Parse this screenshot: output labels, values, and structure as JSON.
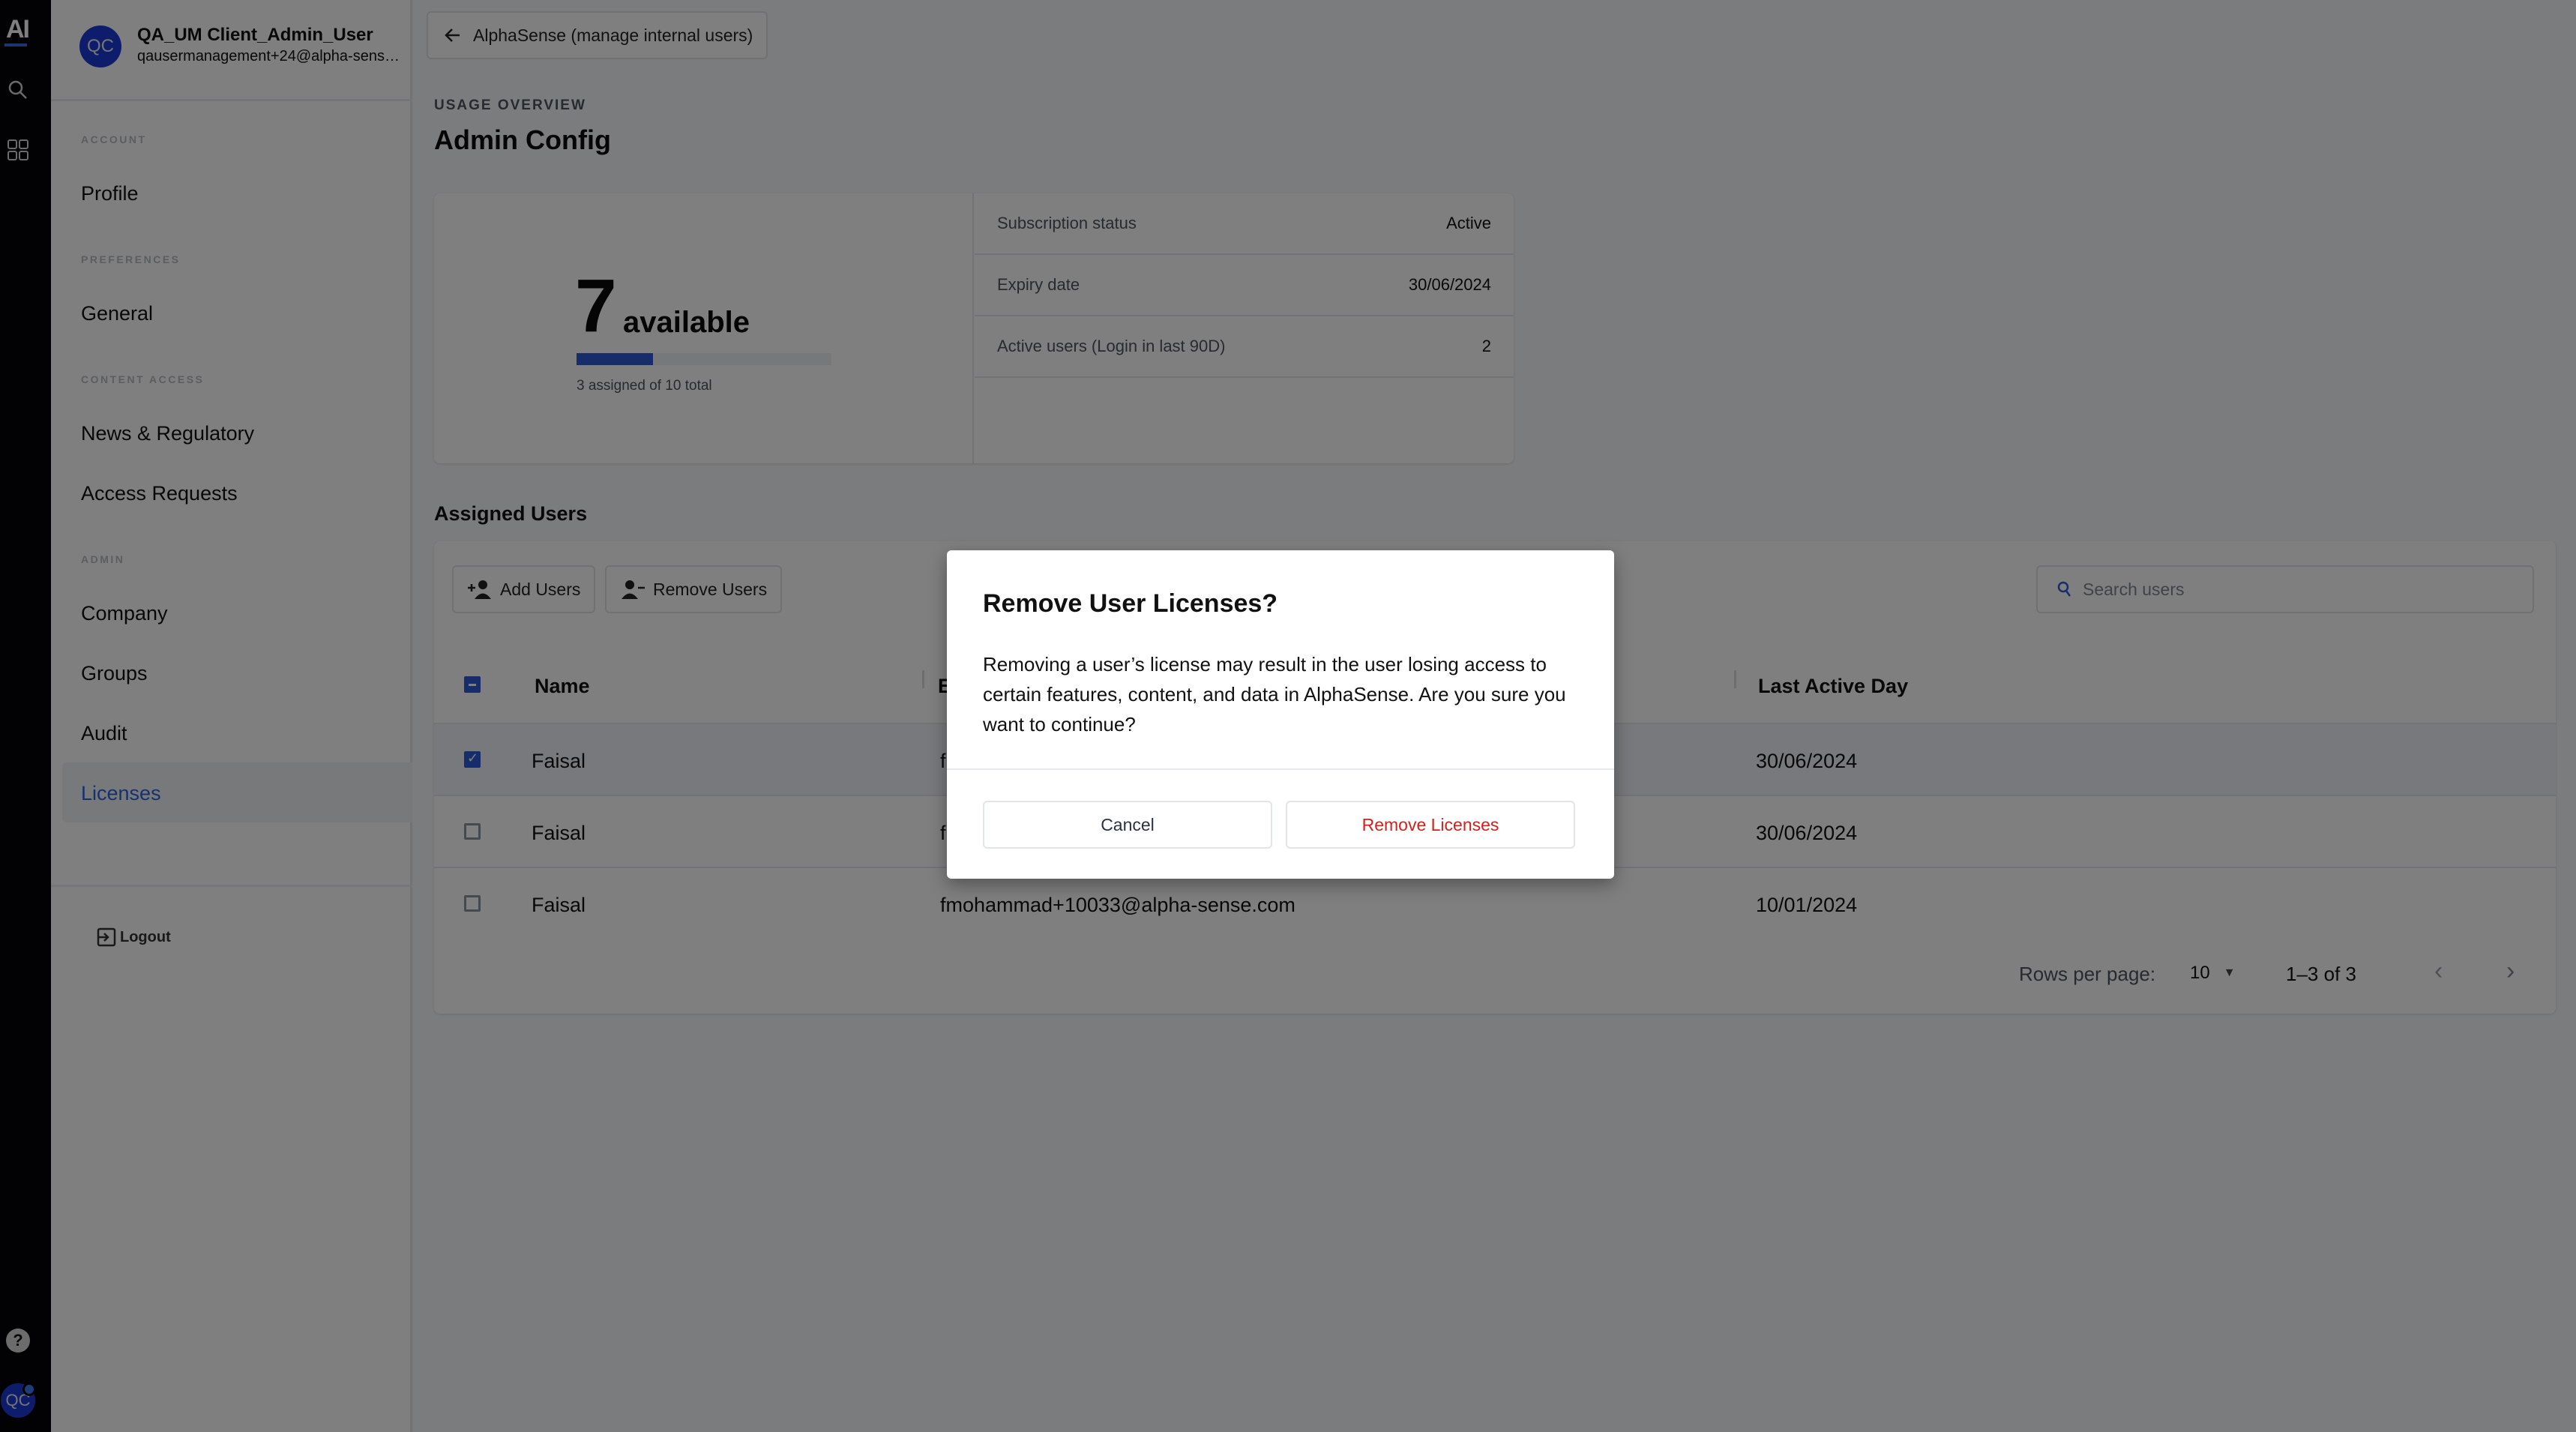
{
  "rail": {
    "logo": "AI",
    "avatar_initials": "QC",
    "help_glyph": "?",
    "icons": [
      "search-icon",
      "apps-grid-icon",
      "help-icon"
    ]
  },
  "sidebar": {
    "user": {
      "initials": "QC",
      "name": "QA_UM Client_Admin_User",
      "email": "qausermanagement+24@alpha-sense...."
    },
    "sections": [
      {
        "label": "ACCOUNT",
        "items": [
          {
            "label": "Profile",
            "active": false
          }
        ]
      },
      {
        "label": "PREFERENCES",
        "items": [
          {
            "label": "General",
            "active": false
          }
        ]
      },
      {
        "label": "CONTENT ACCESS",
        "items": [
          {
            "label": "News & Regulatory",
            "active": false
          },
          {
            "label": "Access Requests",
            "active": false
          }
        ]
      },
      {
        "label": "ADMIN",
        "items": [
          {
            "label": "Company",
            "active": false
          },
          {
            "label": "Groups",
            "active": false
          },
          {
            "label": "Audit",
            "active": false
          },
          {
            "label": "Licenses",
            "active": true
          }
        ]
      }
    ],
    "logout_label": "Logout"
  },
  "main": {
    "back_button_label": "AlphaSense (manage internal users)",
    "eyebrow": "USAGE OVERVIEW",
    "title": "Admin Config",
    "usage": {
      "available_count": "7",
      "available_label": "available",
      "assigned": 3,
      "total": 10,
      "assigned_fraction": 0.3,
      "caption": "3 assigned of 10 total",
      "stats": [
        {
          "label": "Subscription status",
          "value": "Active"
        },
        {
          "label": "Expiry date",
          "value": "30/06/2024"
        },
        {
          "label": "Active users (Login in last 90D)",
          "value": "2"
        }
      ]
    },
    "assigned_users": {
      "title": "Assigned Users",
      "add_button_label": "Add Users",
      "remove_button_label": "Remove Users",
      "search_placeholder": "Search users",
      "search_value": "",
      "columns": [
        "Name",
        "E",
        "Last Active Day"
      ],
      "rows": [
        {
          "name": "Faisal",
          "email": "f",
          "last_active": "30/06/2024",
          "checked": true
        },
        {
          "name": "Faisal",
          "email": "f",
          "last_active": "30/06/2024",
          "checked": false
        },
        {
          "name": "Faisal",
          "email": "fmohammad+10033@alpha-sense.com",
          "last_active": "10/01/2024",
          "checked": false
        }
      ],
      "pagination": {
        "rows_per_page_label": "Rows per page:",
        "rows_per_page_value": "10",
        "range_label": "1–3 of 3"
      }
    }
  },
  "modal": {
    "title": "Remove User Licenses?",
    "body": "Removing a user’s license may result in the user losing access to certain features, content, and data in AlphaSense. Are you sure you want to continue?",
    "cancel_label": "Cancel",
    "confirm_label": "Remove Licenses"
  },
  "colors": {
    "accent": "#2c59d6",
    "danger": "#d0211c",
    "rail_bg": "#04050b"
  }
}
